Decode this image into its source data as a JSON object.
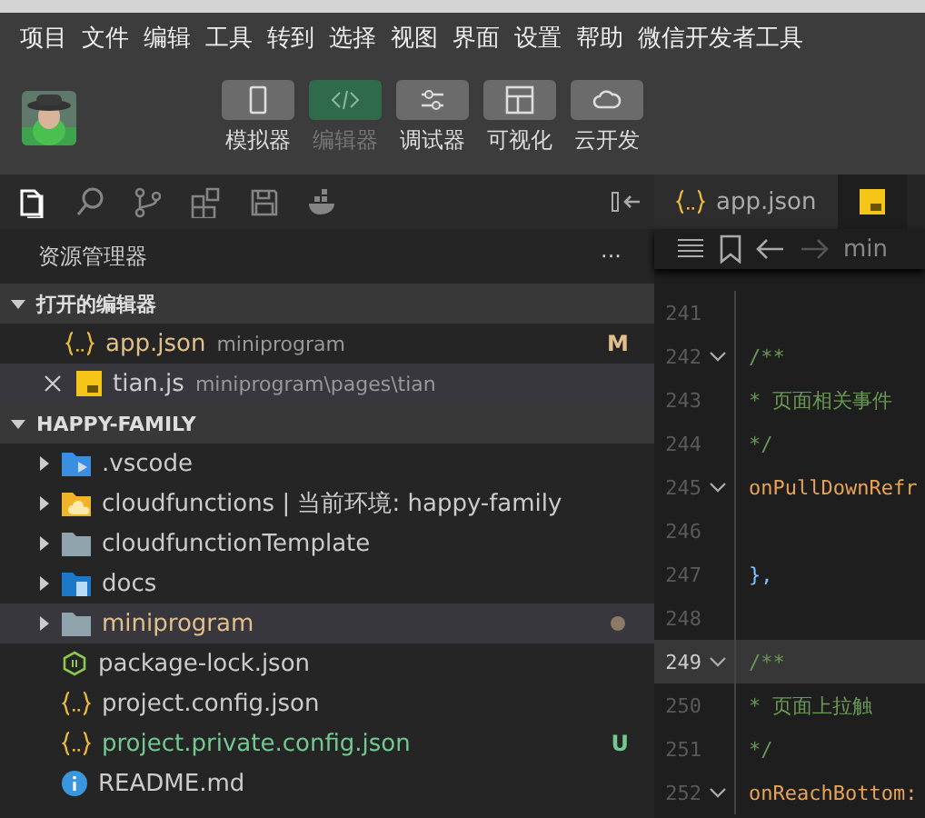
{
  "menu": [
    "项目",
    "文件",
    "编辑",
    "工具",
    "转到",
    "选择",
    "视图",
    "界面",
    "设置",
    "帮助",
    "微信开发者工具"
  ],
  "avatar": {
    "kind": "picture"
  },
  "toolbar": [
    {
      "kind": "phone",
      "label": "模拟器",
      "selected": false
    },
    {
      "kind": "code",
      "label": "编辑器",
      "selected": true
    },
    {
      "kind": "sliders",
      "label": "调试器",
      "selected": false
    },
    {
      "kind": "layout",
      "label": "可视化",
      "selected": false
    },
    {
      "kind": "cloud",
      "label": "云开发",
      "selected": false
    }
  ],
  "activity_bar": [
    {
      "kind": "files",
      "selected": true
    },
    {
      "kind": "search",
      "selected": false
    },
    {
      "kind": "branch",
      "selected": false
    },
    {
      "kind": "extensions",
      "selected": false
    },
    {
      "kind": "save",
      "selected": false
    },
    {
      "kind": "docker",
      "selected": false
    }
  ],
  "explorer": {
    "title": "资源管理器",
    "more": "···",
    "open_editors": {
      "title": "打开的编辑器",
      "expanded": true,
      "items": [
        {
          "kind": "json",
          "name": "app.json",
          "path": "miniprogram",
          "status": "M",
          "color": "#e2c08d",
          "selected": false
        },
        {
          "kind": "js",
          "name": "tian.js",
          "path": "miniprogram\\pages\\tian",
          "color": "#cccccc",
          "selected": true
        }
      ]
    },
    "project": {
      "title": "HAPPY-FAMILY",
      "expanded": true,
      "items": [
        {
          "kind": "vscode",
          "name": ".vscode",
          "expanded": false,
          "modified": false,
          "color": "#cccccc",
          "selected": false
        },
        {
          "kind": "cloud",
          "name": "cloudfunctions | 当前环境: happy-family",
          "expanded": false,
          "modified": false,
          "color": "#cccccc",
          "selected": false
        },
        {
          "kind": "folder",
          "name": "cloudfunctionTemplate",
          "expanded": false,
          "modified": false,
          "color": "#cccccc",
          "selected": false
        },
        {
          "kind": "docs",
          "name": "docs",
          "expanded": false,
          "modified": false,
          "color": "#cccccc",
          "selected": false
        },
        {
          "kind": "folder",
          "name": "miniprogram",
          "expanded": false,
          "modified": true,
          "color": "#e2c08d",
          "selected": true
        },
        {
          "kind": "npm",
          "name": "package-lock.json",
          "modified": false,
          "color": "#cccccc",
          "selected": false
        },
        {
          "kind": "json",
          "name": "project.config.json",
          "modified": false,
          "color": "#cccccc",
          "selected": false
        },
        {
          "kind": "json",
          "name": "project.private.config.json",
          "modified": false,
          "status": "U",
          "color": "#73c991",
          "selected": false
        },
        {
          "kind": "info",
          "name": "README.md",
          "modified": false,
          "color": "#cccccc",
          "selected": false
        }
      ]
    }
  },
  "editor": {
    "tabs": [
      {
        "kind": "json",
        "label": "app.json",
        "selected": false
      },
      {
        "kind": "js",
        "selected": true
      }
    ],
    "breadcrumb": "min",
    "lines": [
      {
        "number": "241",
        "fold": false,
        "current": false
      },
      {
        "number": "242",
        "text": "/**",
        "kind": "comment",
        "fold": true,
        "current": false
      },
      {
        "number": "243",
        "text": " * 页面相关事件",
        "kind": "comment",
        "fold": false,
        "current": false
      },
      {
        "number": "244",
        "text": " */",
        "kind": "comment",
        "fold": false,
        "current": false
      },
      {
        "number": "245",
        "text": "onPullDownRefr",
        "kind": "key",
        "fold": true,
        "current": false
      },
      {
        "number": "246",
        "fold": false,
        "current": false
      },
      {
        "number": "247",
        "text": "},",
        "kind": "brace",
        "fold": false,
        "current": false
      },
      {
        "number": "248",
        "fold": false,
        "current": false
      },
      {
        "number": "249",
        "text": "/**",
        "kind": "comment",
        "fold": true,
        "current": true
      },
      {
        "number": "250",
        "text": " * 页面上拉触",
        "kind": "comment",
        "fold": false,
        "current": false
      },
      {
        "number": "251",
        "text": " */",
        "kind": "comment",
        "fold": false,
        "current": false
      },
      {
        "number": "252",
        "text": "onReachBottom:",
        "kind": "key",
        "fold": true,
        "current": false
      }
    ]
  }
}
